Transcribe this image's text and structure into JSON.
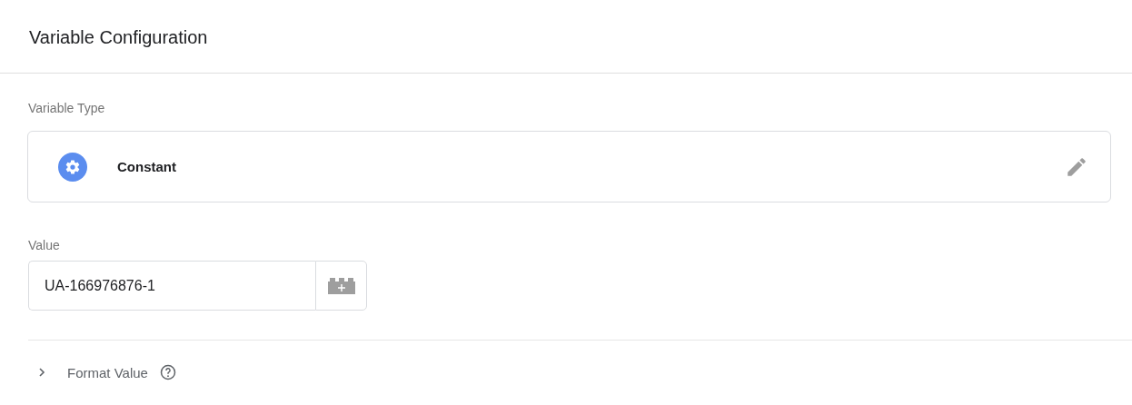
{
  "header": {
    "title": "Variable Configuration"
  },
  "variable_type": {
    "label": "Variable Type",
    "name": "Constant"
  },
  "value": {
    "label": "Value",
    "value": "UA-166976876-1"
  },
  "format_value": {
    "label": "Format Value",
    "expanded": false
  }
}
